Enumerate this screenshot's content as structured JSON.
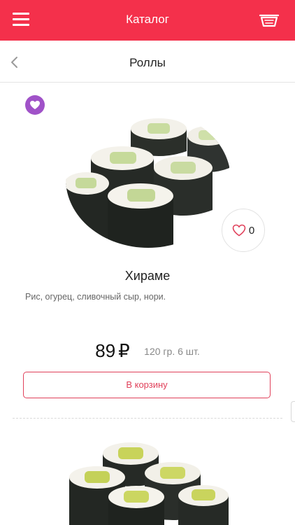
{
  "header": {
    "title": "Каталог",
    "menu_icon": "hamburger-menu-icon",
    "basket_icon": "basket-icon",
    "background": "#f4304b"
  },
  "subheader": {
    "title": "Роллы",
    "back_icon": "chevron-left-icon"
  },
  "product": {
    "name": "Хираме",
    "description": "Рис, огурец, сливочный сыр, нори.",
    "price": "89",
    "currency": "₽",
    "weight": "120 гр. 6 шт.",
    "likes": "0",
    "cart_label": "В корзину",
    "favorite_badge_color": "#a052c8",
    "accent": "#e0405a"
  }
}
